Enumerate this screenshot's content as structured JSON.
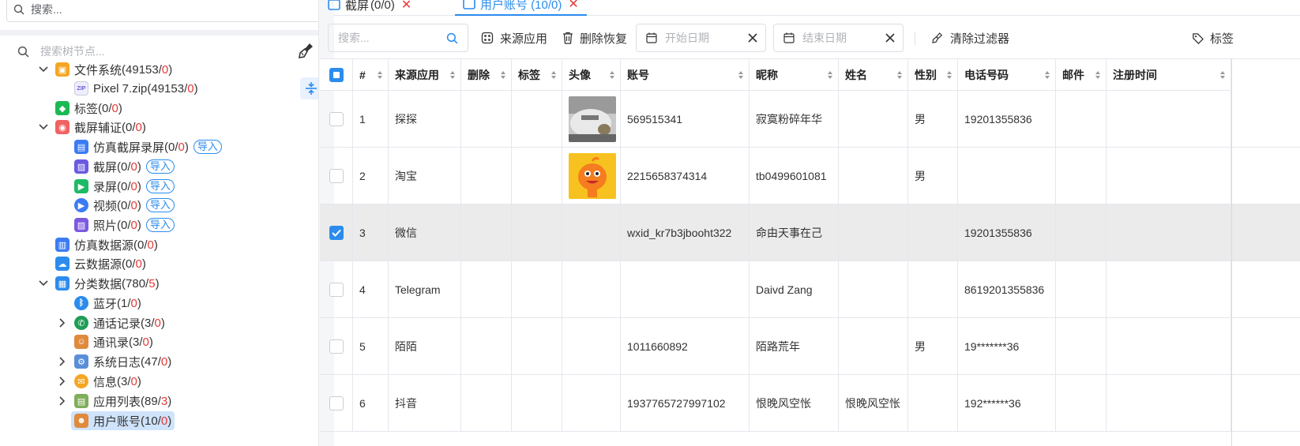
{
  "left_panel": {
    "top_search_placeholder": "搜索...",
    "tree_search_placeholder": "搜索树节点...",
    "tree": [
      {
        "label": "文件系统",
        "total": "49153",
        "flag": "0",
        "icon": "file-system-icon",
        "color": "#f5a623"
      },
      {
        "label": "Pixel 7.zip",
        "total": "49153",
        "flag": "0",
        "icon": "zip-file-icon",
        "color": "#8a7bd8"
      },
      {
        "label": "标签",
        "total": "0",
        "flag": "0",
        "icon": "tag-icon",
        "color": "#1db954"
      },
      {
        "label": "截屏辅证",
        "total": "0",
        "flag": "0",
        "icon": "screenshot-evidence-icon",
        "color": "#f06262"
      },
      {
        "label": "仿真截屏录屏",
        "total": "0",
        "flag": "0",
        "icon": "emulated-capture-icon",
        "color": "#3b7cf5",
        "import": "导入"
      },
      {
        "label": "截屏",
        "total": "0",
        "flag": "0",
        "icon": "screenshot-icon",
        "color": "#6a5ae0",
        "import": "导入"
      },
      {
        "label": "录屏",
        "total": "0",
        "flag": "0",
        "icon": "screen-record-icon",
        "color": "#1fba66",
        "import": "导入"
      },
      {
        "label": "视频",
        "total": "0",
        "flag": "0",
        "icon": "video-icon",
        "color": "#3b7cf5",
        "import": "导入"
      },
      {
        "label": "照片",
        "total": "0",
        "flag": "0",
        "icon": "photo-icon",
        "color": "#7b5ae0",
        "import": "导入"
      },
      {
        "label": "仿真数据源",
        "total": "0",
        "flag": "0",
        "icon": "emulated-datasource-icon",
        "color": "#3b7cf5"
      },
      {
        "label": "云数据源",
        "total": "0",
        "flag": "0",
        "icon": "cloud-datasource-icon",
        "color": "#2b8cee"
      },
      {
        "label": "分类数据",
        "total": "780",
        "flag": "5",
        "icon": "category-data-icon",
        "color": "#2b8cee"
      },
      {
        "label": "蓝牙",
        "total": "1",
        "flag": "0",
        "icon": "bluetooth-icon",
        "color": "#2b8cee"
      },
      {
        "label": "通话记录",
        "total": "3",
        "flag": "0",
        "icon": "call-log-icon",
        "color": "#1f9d55"
      },
      {
        "label": "通讯录",
        "total": "3",
        "flag": "0",
        "icon": "contacts-icon",
        "color": "#e08a3c"
      },
      {
        "label": "系统日志",
        "total": "47",
        "flag": "0",
        "icon": "system-log-icon",
        "color": "#5a8fd8"
      },
      {
        "label": "信息",
        "total": "3",
        "flag": "0",
        "icon": "message-icon",
        "color": "#f5a623"
      },
      {
        "label": "应用列表",
        "total": "89",
        "flag": "3",
        "icon": "app-list-icon",
        "color": "#7fae5a"
      },
      {
        "label": "用户账号",
        "total": "10",
        "flag": "0",
        "icon": "user-account-icon",
        "color": "#e08a3c"
      }
    ]
  },
  "tabs": [
    {
      "label": "(0/0)",
      "prefix": "截屏"
    },
    {
      "label": "用户账号 (10/0)"
    }
  ],
  "toolbar": {
    "search_placeholder": "搜索...",
    "source_app": "来源应用",
    "delete_restore": "删除恢复",
    "start_date": "开始日期",
    "end_date": "结束日期",
    "clear_filters": "清除过滤器",
    "tags": "标签"
  },
  "table": {
    "columns": [
      "#",
      "来源应用",
      "删除",
      "标签",
      "头像",
      "账号",
      "昵称",
      "姓名",
      "性别",
      "电话号码",
      "邮件",
      "注册时间"
    ],
    "rows": [
      {
        "num": "1",
        "app": "探探",
        "deleted": "",
        "tag": "",
        "avatar": "photo",
        "account": "569515341",
        "nickname": "寂寞粉碎年华",
        "name": "",
        "gender": "男",
        "phone": "19201355836",
        "email": "",
        "reg": "",
        "checked": false
      },
      {
        "num": "2",
        "app": "淘宝",
        "deleted": "",
        "tag": "",
        "avatar": "mascot",
        "account": "2215658374314",
        "nickname": "tb0499601081",
        "name": "",
        "gender": "男",
        "phone": "",
        "email": "",
        "reg": "",
        "checked": false
      },
      {
        "num": "3",
        "app": "微信",
        "deleted": "",
        "tag": "",
        "avatar": "",
        "account": "wxid_kr7b3jbooht322",
        "nickname": "命由天事在己",
        "name": "",
        "gender": "",
        "phone": "19201355836",
        "email": "",
        "reg": "",
        "checked": true
      },
      {
        "num": "4",
        "app": "Telegram",
        "deleted": "",
        "tag": "",
        "avatar": "",
        "account": "",
        "nickname": "Daivd Zang",
        "name": "",
        "gender": "",
        "phone": "8619201355836",
        "email": "",
        "reg": "",
        "checked": false
      },
      {
        "num": "5",
        "app": "陌陌",
        "deleted": "",
        "tag": "",
        "avatar": "",
        "account": "1011660892",
        "nickname": "陌路荒年",
        "name": "",
        "gender": "男",
        "phone": "19*******36",
        "email": "",
        "reg": "",
        "checked": false
      },
      {
        "num": "6",
        "app": "抖音",
        "deleted": "",
        "tag": "",
        "avatar": "",
        "account": "1937765727997102",
        "nickname": "恨晚风空怅",
        "name": "恨晚风空怅",
        "gender": "",
        "phone": "192******36",
        "email": "",
        "reg": "",
        "checked": false
      }
    ]
  }
}
